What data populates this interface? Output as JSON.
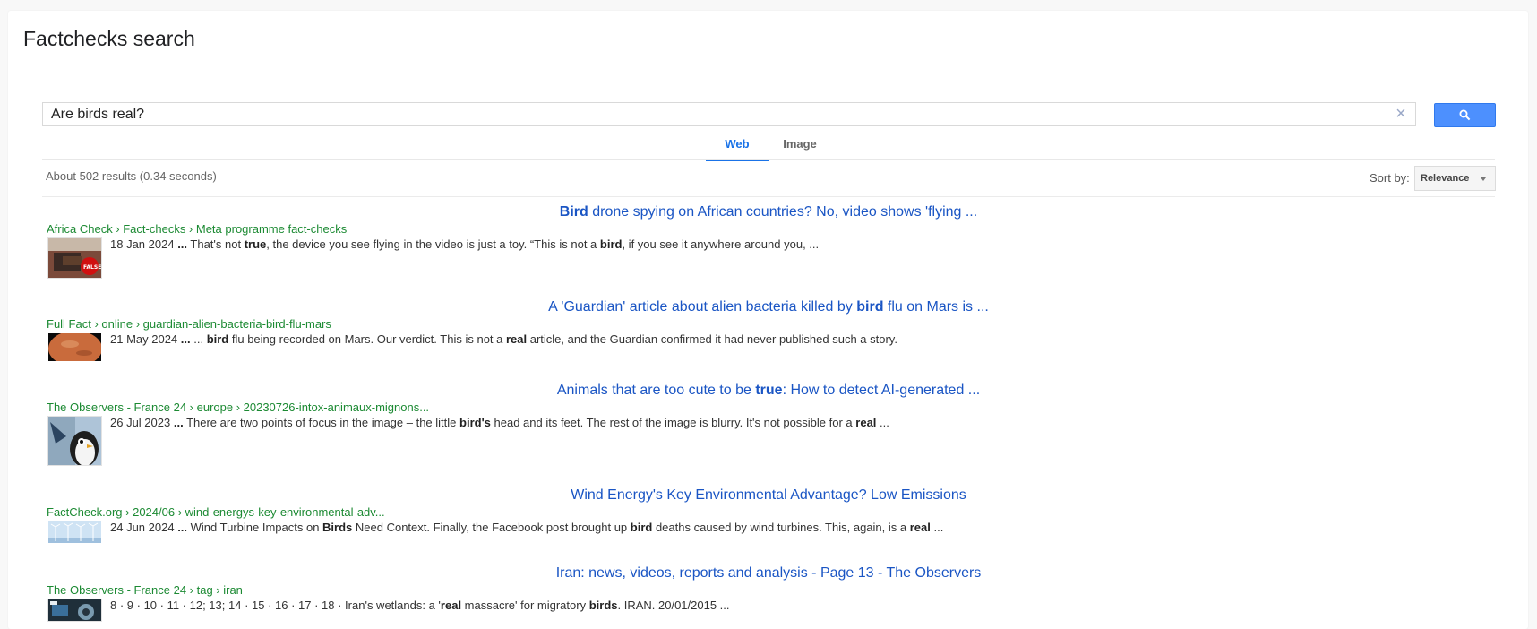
{
  "page": {
    "title": "Factchecks search"
  },
  "search": {
    "query": "Are birds real?",
    "clear_icon": "close-icon",
    "button_icon": "search-icon"
  },
  "tabs": [
    {
      "label": "Web",
      "active": true
    },
    {
      "label": "Image",
      "active": false
    }
  ],
  "results_info": "About 502 results (0.34 seconds)",
  "sort": {
    "label": "Sort by:",
    "value": "Relevance"
  },
  "colors": {
    "accent": "#1a73e8",
    "link": "#1a55c4",
    "url": "#1c8a33",
    "search_button": "#4d90fe"
  },
  "results": [
    {
      "title_parts": [
        {
          "t": "Bird",
          "b": true
        },
        {
          "t": " drone spying on African countries? No, video shows 'flying ...",
          "b": false
        }
      ],
      "url": "Africa Check › Fact-checks › Meta programme fact-checks",
      "snippet_parts": [
        {
          "t": "18 Jan 2024 ",
          "b": false
        },
        {
          "t": "...",
          "b": true
        },
        {
          "t": " That's not ",
          "b": false
        },
        {
          "t": "true",
          "b": true
        },
        {
          "t": ", the device you see flying in the video is just a toy. “This is not a ",
          "b": false
        },
        {
          "t": "bird",
          "b": true
        },
        {
          "t": ", if you see it anywhere around you, ...",
          "b": false
        }
      ],
      "thumb": "false-stamp-thumbnail"
    },
    {
      "title_parts": [
        {
          "t": "A 'Guardian' article about alien bacteria killed by ",
          "b": false
        },
        {
          "t": "bird",
          "b": true
        },
        {
          "t": " flu on Mars is ...",
          "b": false
        }
      ],
      "url": "Full Fact › online › guardian-alien-bacteria-bird-flu-mars",
      "snippet_parts": [
        {
          "t": "21 May 2024 ",
          "b": false
        },
        {
          "t": "...",
          "b": true
        },
        {
          "t": " ... ",
          "b": false
        },
        {
          "t": "bird",
          "b": true
        },
        {
          "t": " flu being recorded on Mars. Our verdict. This is not a ",
          "b": false
        },
        {
          "t": "real",
          "b": true
        },
        {
          "t": " article, and the Guardian confirmed it had never published such a story.",
          "b": false
        }
      ],
      "thumb": "mars-thumbnail"
    },
    {
      "title_parts": [
        {
          "t": "Animals that are too cute to be ",
          "b": false
        },
        {
          "t": "true",
          "b": true
        },
        {
          "t": ": How to detect AI-generated ...",
          "b": false
        }
      ],
      "url": "The Observers - France 24 › europe › 20230726-intox-animaux-mignons...",
      "snippet_parts": [
        {
          "t": "26 Jul 2023 ",
          "b": false
        },
        {
          "t": "...",
          "b": true
        },
        {
          "t": " There are two points of focus in the image – the little ",
          "b": false
        },
        {
          "t": "bird's",
          "b": true
        },
        {
          "t": " head and its feet. The rest of the image is blurry. It's not possible for a ",
          "b": false
        },
        {
          "t": "real",
          "b": true
        },
        {
          "t": " ...",
          "b": false
        }
      ],
      "thumb": "penguin-thumbnail"
    },
    {
      "title_parts": [
        {
          "t": "Wind Energy's Key Environmental Advantage? Low Emissions",
          "b": false
        }
      ],
      "url": "FactCheck.org › 2024/06 › wind-energys-key-environmental-adv...",
      "snippet_parts": [
        {
          "t": "24 Jun 2024 ",
          "b": false
        },
        {
          "t": "...",
          "b": true
        },
        {
          "t": " Wind Turbine Impacts on ",
          "b": false
        },
        {
          "t": "Birds",
          "b": true
        },
        {
          "t": " Need Context. Finally, the Facebook post brought up ",
          "b": false
        },
        {
          "t": "bird",
          "b": true
        },
        {
          "t": " deaths caused by wind turbines. This, again, is a ",
          "b": false
        },
        {
          "t": "real",
          "b": true
        },
        {
          "t": " ...",
          "b": false
        }
      ],
      "thumb": "wind-turbines-thumbnail"
    },
    {
      "title_parts": [
        {
          "t": "Iran: news, videos, reports and analysis - Page 13 - The Observers",
          "b": false
        }
      ],
      "url": "The Observers - France 24 › tag › iran",
      "snippet_parts": [
        {
          "t": "8 · 9 · 10 · 11 · 12; 13; 14 · 15 · 16 · 17 · 18 · Iran's wetlands: a '",
          "b": false
        },
        {
          "t": "real",
          "b": true
        },
        {
          "t": " massacre' for migratory ",
          "b": false
        },
        {
          "t": "birds",
          "b": true
        },
        {
          "t": ". IRAN. 20/01/2015 ...",
          "b": false
        }
      ],
      "thumb": "observers-video-thumbnail"
    }
  ]
}
